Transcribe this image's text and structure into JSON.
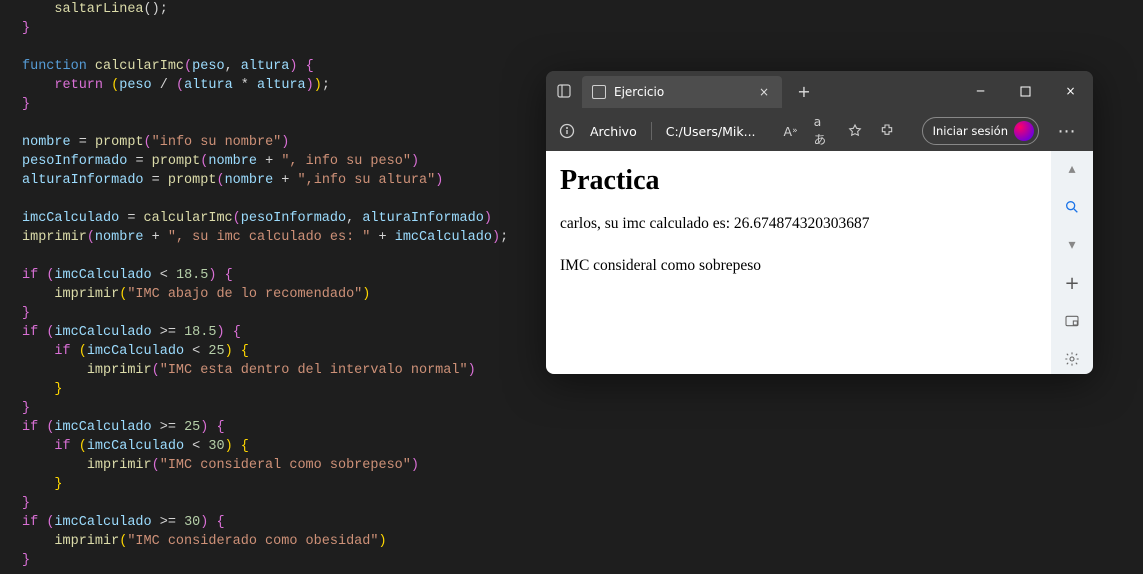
{
  "code": {
    "l1": "saltarLinea",
    "l2": "calcularImc",
    "l3_peso": "peso",
    "l3_altura": "altura",
    "l4_return": "return",
    "l5_nombre": "nombre",
    "l5_prompt": "prompt",
    "l5_s1": "\"info su nombre\"",
    "l6_pesoInformado": "pesoInformado",
    "l6_s1": "\", info su peso\"",
    "l7_alturaInformado": "alturaInformado",
    "l7_s1": "\",info su altura\"",
    "l8_imcCalculado": "imcCalculado",
    "l9_imprimir": "imprimir",
    "l9_s1": "\", su imc calculado es: \"",
    "n185": "18.5",
    "n25": "25",
    "n30": "30",
    "s_bajo": "\"IMC abajo de lo recomendado\"",
    "s_normal": "\"IMC esta dentro del intervalo normal\"",
    "s_sobre": "\"IMC consideral como sobrepeso\"",
    "s_obes": "\"IMC considerado como obesidad\"",
    "kw_function": "function",
    "kw_if": "if",
    "kw_return": "return"
  },
  "browser": {
    "tab_title": "Ejercicio",
    "addr_label": "Archivo",
    "addr_path": "C:/Users/Mik...",
    "login": "Iniciar sesión",
    "page_title": "Practica",
    "page_line1": "carlos, su imc calculado es: 26.674874320303687",
    "page_line2": "IMC consideral como sobrepeso"
  }
}
